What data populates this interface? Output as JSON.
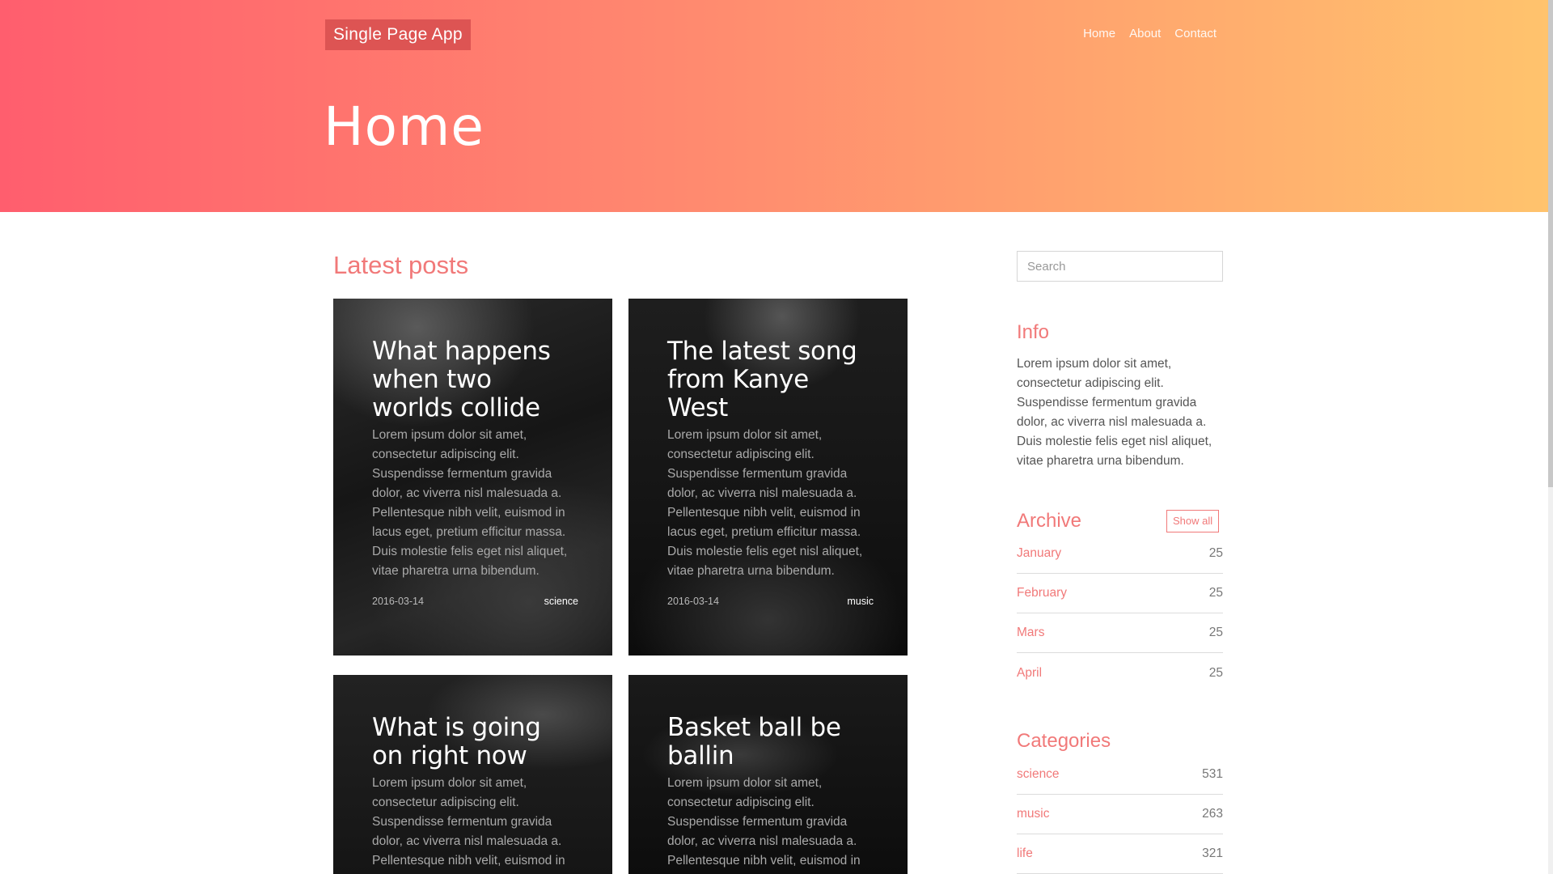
{
  "header": {
    "brand": "Single Page App",
    "nav": [
      "Home",
      "About",
      "Contact"
    ],
    "page_title": "Home"
  },
  "main": {
    "heading": "Latest posts",
    "posts": [
      {
        "title": "What happens when two worlds collide",
        "excerpt": "Lorem ipsum dolor sit amet, consectetur adipiscing elit. Suspendisse fermentum gravida dolor, ac viverra nisl malesuada a. Pellentesque nibh velit, euismod in lacus eget, pretium efficitur massa. Duis molestie felis eget nisl aliquet, vitae pharetra urna bibendum.",
        "date": "2016-03-14",
        "tag": "science"
      },
      {
        "title": "The latest song from Kanye West",
        "excerpt": "Lorem ipsum dolor sit amet, consectetur adipiscing elit. Suspendisse fermentum gravida dolor, ac viverra nisl malesuada a. Pellentesque nibh velit, euismod in lacus eget, pretium efficitur massa. Duis molestie felis eget nisl aliquet, vitae pharetra urna bibendum.",
        "date": "2016-03-14",
        "tag": "music"
      },
      {
        "title": "What is going on right now",
        "excerpt": "Lorem ipsum dolor sit amet, consectetur adipiscing elit. Suspendisse fermentum gravida dolor, ac viverra nisl malesuada a. Pellentesque nibh velit, euismod in",
        "date": "",
        "tag": ""
      },
      {
        "title": "Basket ball be ballin",
        "excerpt": "Lorem ipsum dolor sit amet, consectetur adipiscing elit. Suspendisse fermentum gravida dolor, ac viverra nisl malesuada a. Pellentesque nibh velit, euismod in",
        "date": "",
        "tag": ""
      }
    ]
  },
  "sidebar": {
    "search_placeholder": "Search",
    "info": {
      "heading": "Info",
      "text": "Lorem ipsum dolor sit amet, consectetur adipiscing elit. Suspendisse fermentum gravida dolor, ac viverra nisl malesuada a. Duis molestie felis eget nisl aliquet, vitae pharetra urna bibendum."
    },
    "archive": {
      "heading": "Archive",
      "show_all": "Show all",
      "items": [
        {
          "label": "January",
          "count": "25"
        },
        {
          "label": "February",
          "count": "25"
        },
        {
          "label": "Mars",
          "count": "25"
        },
        {
          "label": "April",
          "count": "25"
        }
      ]
    },
    "categories": {
      "heading": "Categories",
      "items": [
        {
          "label": "science",
          "count": "531"
        },
        {
          "label": "music",
          "count": "263"
        },
        {
          "label": "life",
          "count": "321"
        }
      ]
    }
  },
  "colors": {
    "accent": "#f17979",
    "brand_bg": "#dd5453",
    "gradient_start": "#ff5e6e",
    "gradient_end": "#ffc36d"
  }
}
